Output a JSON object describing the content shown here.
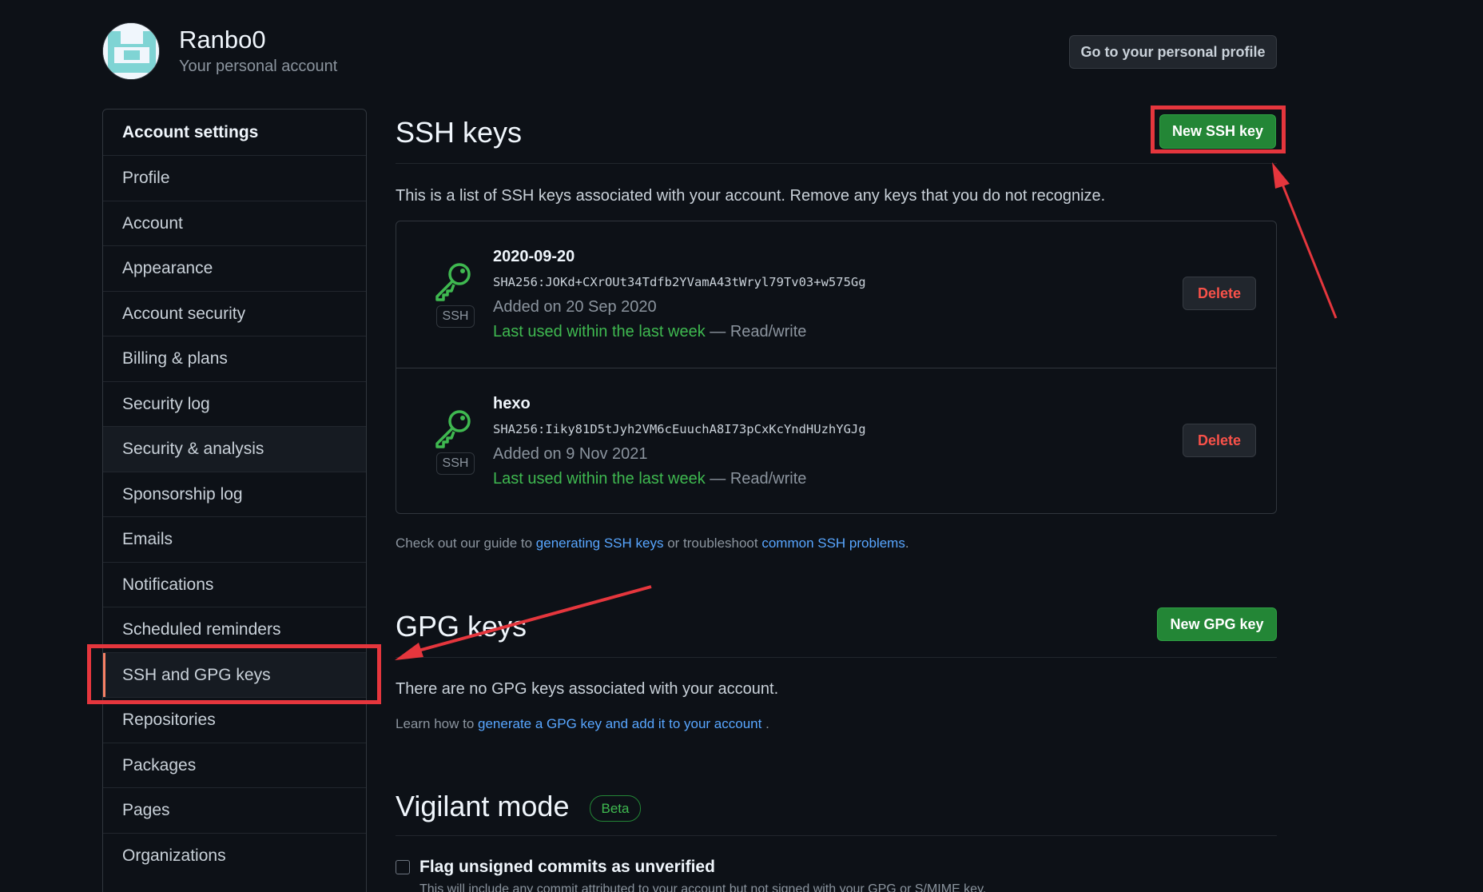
{
  "header": {
    "username": "Ranbo0",
    "subtitle": "Your personal account",
    "profile_button": "Go to your personal profile"
  },
  "sidebar": {
    "items": [
      {
        "label": "Account settings"
      },
      {
        "label": "Profile"
      },
      {
        "label": "Account"
      },
      {
        "label": "Appearance"
      },
      {
        "label": "Account security"
      },
      {
        "label": "Billing & plans"
      },
      {
        "label": "Security log"
      },
      {
        "label": "Security & analysis"
      },
      {
        "label": "Sponsorship log"
      },
      {
        "label": "Emails"
      },
      {
        "label": "Notifications"
      },
      {
        "label": "Scheduled reminders"
      },
      {
        "label": "SSH and GPG keys"
      },
      {
        "label": "Repositories"
      },
      {
        "label": "Packages"
      },
      {
        "label": "Pages"
      },
      {
        "label": "Organizations"
      }
    ],
    "selected": "SSH and GPG keys"
  },
  "ssh": {
    "title": "SSH keys",
    "new_button": "New SSH key",
    "description": "This is a list of SSH keys associated with your account. Remove any keys that you do not recognize.",
    "keys": [
      {
        "title": "2020-09-20",
        "fingerprint": "SHA256:JOKd+CXrOUt34Tdfb2YVamA43tWryl79Tv03+w575Gg",
        "added": "Added on 20 Sep 2020",
        "last_used": "Last used within the last week",
        "access": " — Read/write",
        "badge": "SSH",
        "delete_label": "Delete"
      },
      {
        "title": "hexo",
        "fingerprint": "SHA256:Iiky81D5tJyh2VM6cEuuchA8I73pCxKcYndHUzhYGJg",
        "added": "Added on 9 Nov 2021",
        "last_used": "Last used within the last week",
        "access": " — Read/write",
        "badge": "SSH",
        "delete_label": "Delete"
      }
    ],
    "guide_prefix": "Check out our guide to ",
    "guide_link1": "generating SSH keys",
    "guide_mid": " or troubleshoot ",
    "guide_link2": "common SSH problems",
    "guide_suffix": "."
  },
  "gpg": {
    "title": "GPG keys",
    "new_button": "New GPG key",
    "empty_text": "There are no GPG keys associated with your account.",
    "learn_prefix": "Learn how to ",
    "learn_link": "generate a GPG key and add it to your account",
    "learn_suffix": " ."
  },
  "vigilant": {
    "title": "Vigilant mode",
    "badge": "Beta",
    "checkbox_label": "Flag unsigned commits as unverified",
    "checkbox_note": "This will include any commit attributed to your account but not signed with your GPG or S/MIME key."
  },
  "colors": {
    "accent_green": "#238636",
    "link_blue": "#58a6ff",
    "danger_red": "#f85149",
    "annotation_red": "#e5363d"
  }
}
